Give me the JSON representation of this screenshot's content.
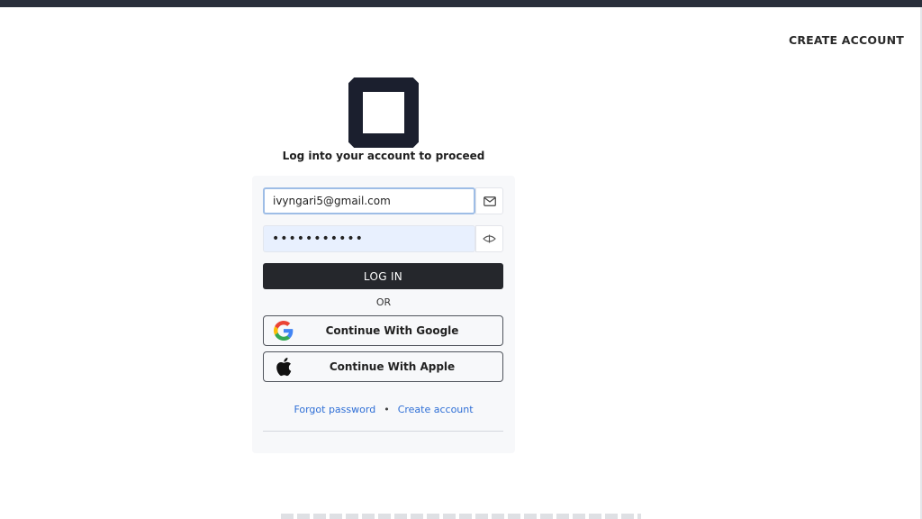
{
  "header": {
    "create_account": "CREATE ACCOUNT"
  },
  "login": {
    "subtitle": "Log into your account to proceed",
    "email_value": "ivyngari5@gmail.com",
    "password_value": "•••••••••••",
    "login_button": "LOG IN",
    "or_text": "OR",
    "google_button": "Continue With Google",
    "apple_button": "Continue With Apple",
    "forgot_password": "Forgot password",
    "separator": "•",
    "create_account": "Create account"
  },
  "colors": {
    "primary_button": "#25272c",
    "link": "#2f6fd6",
    "logo": "#1b1f2e"
  },
  "icons": [
    "envelope-icon",
    "eye-icon",
    "google-icon",
    "apple-icon"
  ]
}
